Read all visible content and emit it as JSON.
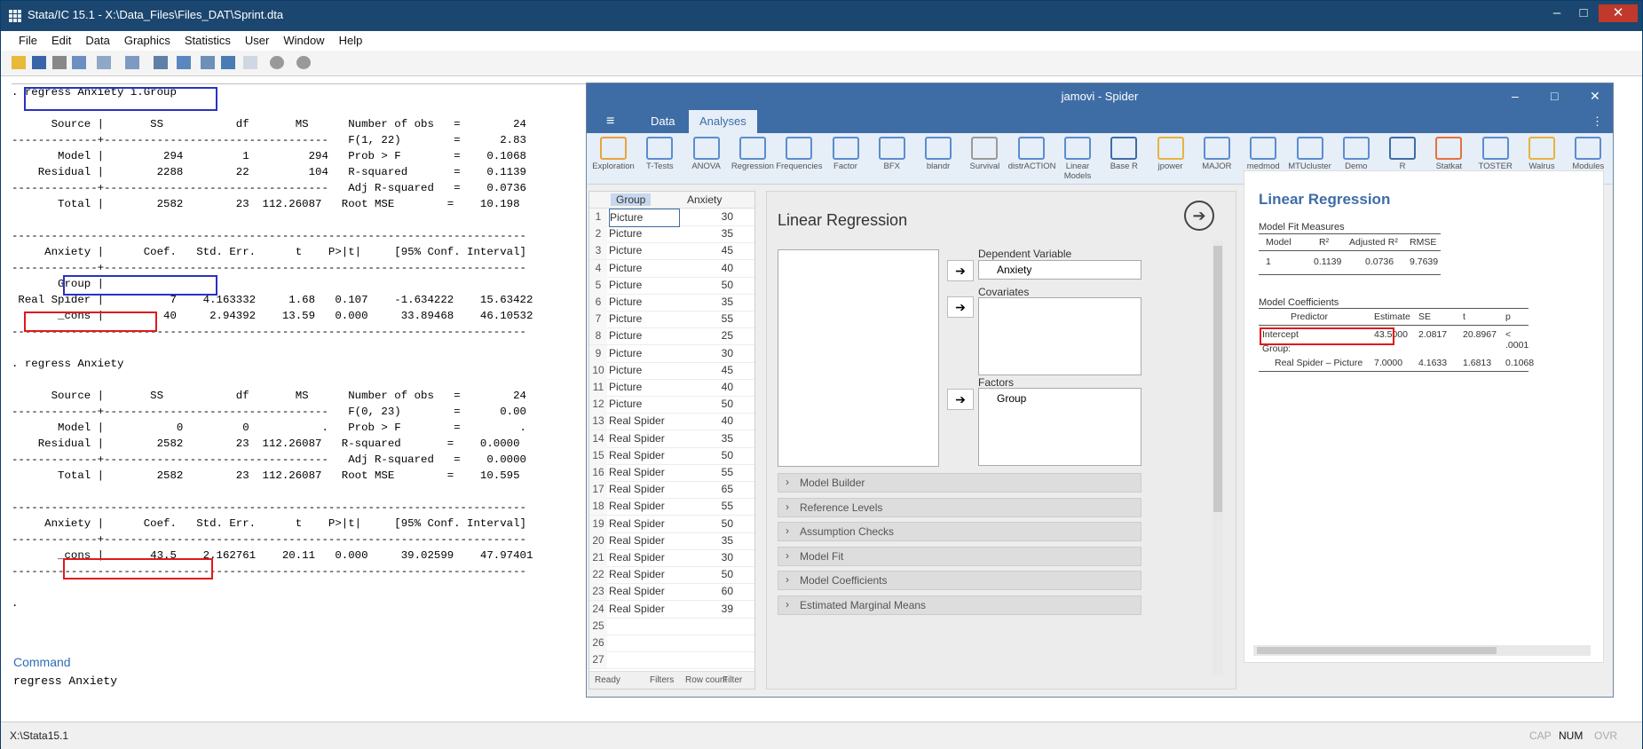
{
  "stata": {
    "title": "Stata/IC 15.1 - X:\\Data_Files\\Files_DAT\\Sprint.dta",
    "window_controls": [
      "–",
      "□",
      "✕"
    ],
    "menu": [
      "File",
      "Edit",
      "Data",
      "Graphics",
      "Statistics",
      "User",
      "Window",
      "Help"
    ],
    "results_lines": [
      ". regress Anxiety i.Group",
      "",
      "      Source |       SS           df       MS      Number of obs   =        24",
      "-------------+----------------------------------   F(1, 22)        =      2.83",
      "       Model |         294         1         294   Prob > F        =    0.1068",
      "    Residual |        2288        22         104   R-squared       =    0.1139",
      "-------------+----------------------------------   Adj R-squared   =    0.0736",
      "       Total |        2582        23  112.26087   Root MSE        =    10.198",
      "",
      "------------------------------------------------------------------------------",
      "     Anxiety |      Coef.   Std. Err.      t    P>|t|     [95% Conf. Interval]",
      "-------------+----------------------------------------------------------------",
      "       Group |",
      " Real Spider |          7    4.163332     1.68   0.107    -1.634222    15.63422",
      "       _cons |         40     2.94392    13.59   0.000     33.89468    46.10532",
      "------------------------------------------------------------------------------",
      "",
      ". regress Anxiety",
      "",
      "      Source |       SS           df       MS      Number of obs   =        24",
      "-------------+----------------------------------   F(0, 23)        =      0.00",
      "       Model |           0         0           .   Prob > F        =         .",
      "    Residual |        2582        23  112.26087   R-squared       =    0.0000",
      "-------------+----------------------------------   Adj R-squared   =    0.0000",
      "       Total |        2582        23  112.26087   Root MSE        =    10.595",
      "",
      "------------------------------------------------------------------------------",
      "     Anxiety |      Coef.   Std. Err.      t    P>|t|     [95% Conf. Interval]",
      "-------------+----------------------------------------------------------------",
      "       _cons |       43.5    2.162761    20.11   0.000     39.02599    47.97401",
      "------------------------------------------------------------------------------",
      "",
      "."
    ],
    "command_label": "Command",
    "command_text": "regress Anxiety",
    "status_path": "X:\\Stata15.1",
    "status_caps": "CAP",
    "status_num": "NUM",
    "status_ovr": "OVR"
  },
  "jamovi": {
    "title": "jamovi - Spider",
    "tabs": [
      "Data",
      "Analyses"
    ],
    "ribbon": [
      "Exploration",
      "T-Tests",
      "ANOVA",
      "Regression",
      "Frequencies",
      "Factor",
      "BFX",
      "blandr",
      "Survival",
      "distrACTION",
      "Linear Models",
      "Base R",
      "jpower",
      "MAJOR",
      "medmod",
      "MTUcluster",
      "Demo",
      "R",
      "Statkat",
      "TOSTER",
      "Walrus",
      "Modules"
    ],
    "colors": {
      "accent": "#3e6da6",
      "highlight_red": "#e0191c",
      "highlight_blue": "#2a32c4"
    },
    "sheet": {
      "columns": [
        "Group",
        "Anxiety"
      ],
      "rows": [
        [
          "Picture",
          "30"
        ],
        [
          "Picture",
          "35"
        ],
        [
          "Picture",
          "45"
        ],
        [
          "Picture",
          "40"
        ],
        [
          "Picture",
          "50"
        ],
        [
          "Picture",
          "35"
        ],
        [
          "Picture",
          "55"
        ],
        [
          "Picture",
          "25"
        ],
        [
          "Picture",
          "30"
        ],
        [
          "Picture",
          "45"
        ],
        [
          "Picture",
          "40"
        ],
        [
          "Picture",
          "50"
        ],
        [
          "Real Spider",
          "40"
        ],
        [
          "Real Spider",
          "35"
        ],
        [
          "Real Spider",
          "50"
        ],
        [
          "Real Spider",
          "55"
        ],
        [
          "Real Spider",
          "65"
        ],
        [
          "Real Spider",
          "55"
        ],
        [
          "Real Spider",
          "50"
        ],
        [
          "Real Spider",
          "35"
        ],
        [
          "Real Spider",
          "30"
        ],
        [
          "Real Spider",
          "50"
        ],
        [
          "Real Spider",
          "60"
        ],
        [
          "Real Spider",
          "39"
        ],
        [
          "",
          ""
        ],
        [
          "",
          ""
        ],
        [
          "",
          ""
        ]
      ],
      "status": [
        "Ready",
        "Filters",
        "Row count",
        "Filter"
      ]
    },
    "options": {
      "title": "Linear Regression",
      "dependent_label": "Dependent Variable",
      "dependent_value": "Anxiety",
      "covariates_label": "Covariates",
      "factors_label": "Factors",
      "factors_value": "Group",
      "sections": [
        "Model Builder",
        "Reference Levels",
        "Assumption Checks",
        "Model Fit",
        "Model Coefficients",
        "Estimated Marginal Means"
      ]
    },
    "results": {
      "title": "Linear Regression",
      "fit_title": "Model Fit Measures",
      "fit_headers": [
        "Model",
        "R²",
        "Adjusted R²",
        "RMSE"
      ],
      "fit_row": [
        "1",
        "0.1139",
        "0.0736",
        "9.7639"
      ],
      "coef_title": "Model Coefficients",
      "coef_headers": [
        "Predictor",
        "Estimate",
        "SE",
        "t",
        "p"
      ],
      "coef_rows": [
        [
          "Intercept",
          "43.5000",
          "2.0817",
          "20.8967",
          "< .0001"
        ],
        [
          "Group:",
          "",
          "",
          "",
          ""
        ],
        [
          "Real Spider – Picture",
          "7.0000",
          "4.1633",
          "1.6813",
          "0.1068"
        ]
      ]
    }
  }
}
